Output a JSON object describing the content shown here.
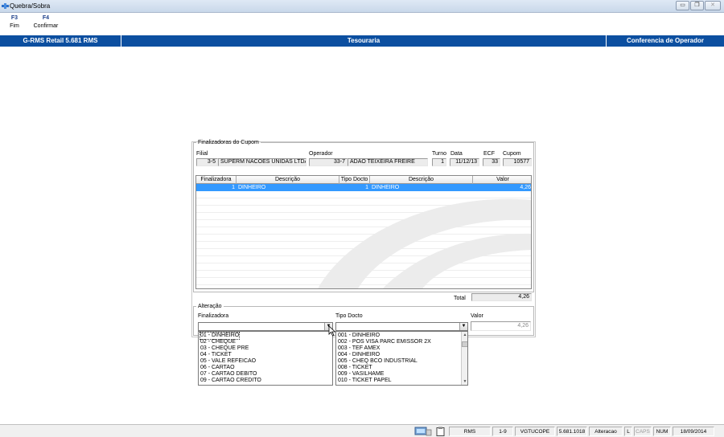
{
  "window": {
    "title": "Quebra/Sobra",
    "buttons": {
      "minimize": "▭",
      "maximize": "❐",
      "close": "✕"
    }
  },
  "toolbar": [
    {
      "key": "F3",
      "label": "Fim"
    },
    {
      "key": "F4",
      "label": "Confirmar"
    }
  ],
  "header": {
    "left": "G-RMS Retail 5.681 RMS",
    "center": "Tesouraria",
    "right": "Conferencia de Operador",
    "color": "#0c4fa0"
  },
  "cupom": {
    "legend": "Finalizadoras do Cupom",
    "filial_label": "Filial",
    "filial_code": "3-5",
    "filial_name": "SUPERM NACOES UNIDAS LTDA",
    "operador_label": "Operador",
    "operador_code": "33-7",
    "operador_name": "ADAO TEIXEIRA FREIRE",
    "turno_label": "Turno",
    "turno": "1",
    "data_label": "Data",
    "data": "11/12/13",
    "ecf_label": "ECF",
    "ecf": "33",
    "cupom_label": "Cupom",
    "cupom": "10577"
  },
  "grid": {
    "columns": [
      "Finalizadora",
      "Descrição",
      "Tipo Docto",
      "Descrição",
      "Valor"
    ],
    "rows": [
      {
        "finalizadora": "1",
        "descricao": "DINHEIRO",
        "tipo_docto": "1",
        "descricao2": "DINHEIRO",
        "valor": "4,26",
        "selected": true
      }
    ],
    "selection_color": "#3399ff"
  },
  "total": {
    "label": "Total",
    "value": "4,26"
  },
  "alteracao": {
    "legend": "Alteração",
    "finalizadora_label": "Finalizadora",
    "finalizadora_value": "",
    "tipo_docto_label": "Tipo Docto",
    "tipo_docto_value": "",
    "valor_label": "Valor",
    "valor_value": "4,26"
  },
  "finalizadora_options": [
    "01 - DINHEIRO",
    "02 - CHEQUE",
    "03 - CHEQUE PRE",
    "04 - TICKET",
    "05 - VALE REFEICAO",
    "06 - CARTAO",
    "07 - CARTAO DEBITO",
    "09 - CARTAO CREDITO"
  ],
  "tipo_docto_options": [
    "001 - DINHEIRO",
    "002 - POS VISA PARC EMISSOR  2X",
    "003 - TEF AMEX",
    "004 - DINHEIRO",
    "005 - CHEQ BCO INDUSTRIAL",
    "008 - TICKET",
    "009 - VASILHAME",
    "010 - TICKET PAPEL"
  ],
  "statusbar": {
    "module": "RMS",
    "page": "1-9",
    "user": "VGTUCOPE",
    "version": "5.681.1018",
    "mode": "Alteracao",
    "l": "L",
    "caps": "CAPS",
    "num": "NUM",
    "date": "18/09/2014"
  }
}
